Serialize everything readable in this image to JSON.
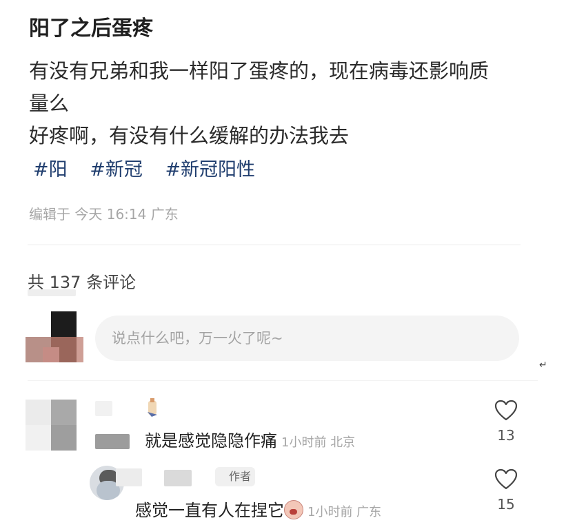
{
  "post": {
    "title": "阳了之后蛋疼",
    "lines": [
      "有没有兄弟和我一样阳了蛋疼的，现在病毒还影响质",
      "量么",
      "好疼啊，有没有什么缓解的办法我去"
    ],
    "tags": [
      "#阳",
      "#新冠",
      "#新冠阳性"
    ],
    "meta": "编辑于 今天 16:14 广东"
  },
  "comments_section": {
    "count_label": "共 137 条评论",
    "input_placeholder": "说点什么吧，万一火了呢~",
    "return_mark": "↵"
  },
  "comments": [
    {
      "text": "就是感觉隐隐作痛",
      "meta": "1小时前 北京",
      "likes": "13"
    },
    {
      "text": "感觉一直有人在捏它",
      "meta": "1小时前 广东",
      "likes": "15",
      "badge": "作者",
      "emoji": "screaming-face-icon"
    }
  ],
  "colors": {
    "tag": "#1f3d6e",
    "meta": "#a6a6a6",
    "input_bg": "#f4f4f4"
  }
}
